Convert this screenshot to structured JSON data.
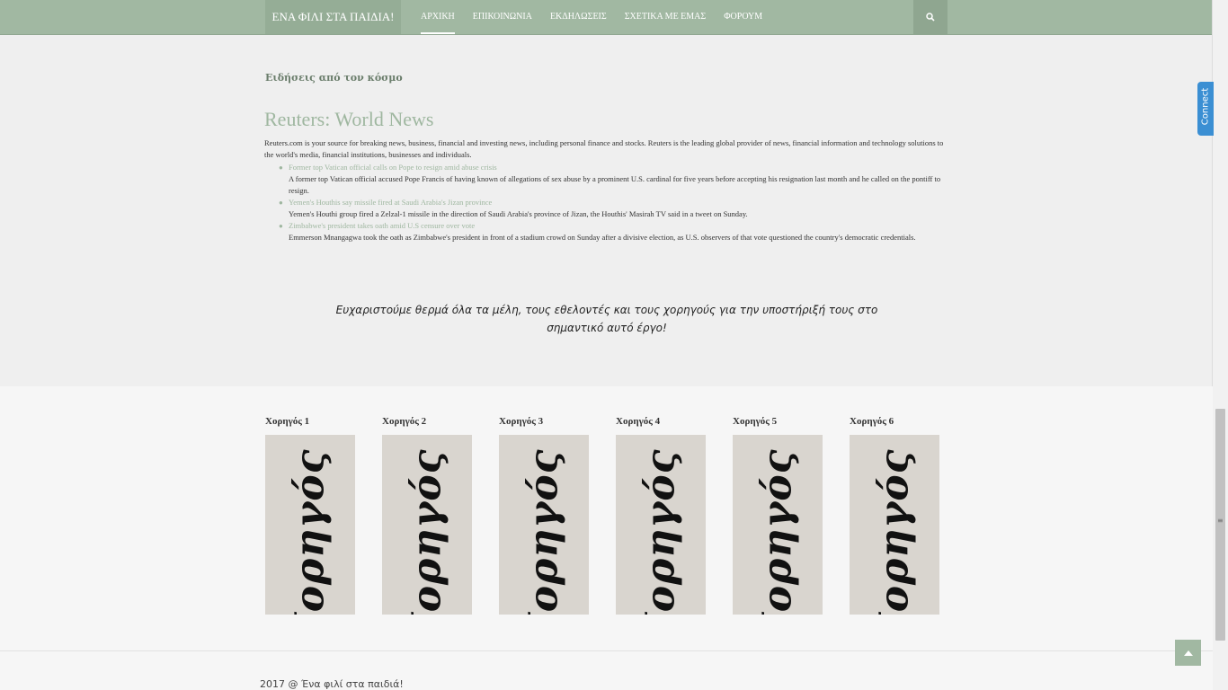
{
  "header": {
    "brand": "ΕΝΑ ΦΙΛΙ ΣΤΑ ΠΑΙΔΙΑ!",
    "nav": [
      {
        "label": "ΑΡΧΙΚΗ",
        "active": true
      },
      {
        "label": "ΕΠΙΚΟΙΝΩΝΙΑ",
        "active": false
      },
      {
        "label": "ΕΚΔΗΛΩΣΕΙΣ",
        "active": false
      },
      {
        "label": "ΣΧΕΤΙΚΑ ΜΕ ΕΜΑΣ",
        "active": false
      },
      {
        "label": "ΦΟΡΟΥΜ",
        "active": false
      }
    ],
    "search_icon": "search-icon"
  },
  "connect_tab": {
    "label": "Connect"
  },
  "news": {
    "heading": "Ειδήσεις από τον κόσμο",
    "feed_title": "Reuters: World News",
    "feed_description": "Reuters.com is your source for breaking news, business, financial and investing news, including personal finance and stocks. Reuters is the leading global provider of news, financial information and technology solutions to the world's media, financial institutions, businesses and individuals.",
    "items": [
      {
        "title": "Former top Vatican official calls on Pope to resign amid abuse crisis",
        "summary": "A former top Vatican official accused Pope Francis of having known of allegations of sex abuse by a prominent U.S. cardinal for five years before accepting his resignation last month and he called on the pontiff to resign."
      },
      {
        "title": "Yemen's Houthis say missile fired at Saudi Arabia's Jizan province",
        "summary": "Yemen's Houthi group fired a Zelzal-1 missile in the direction of Saudi Arabia's province of Jizan, the Houthis' Masirah TV said in a tweet on Sunday."
      },
      {
        "title": "Zimbabwe's president takes oath amid U.S censure over vote",
        "summary": "Emmerson Mnangagwa took the oath as Zimbabwe's president in front of a stadium crowd on Sunday after a divisive election, as U.S. observers of that vote questioned the country's democratic credentials."
      }
    ]
  },
  "thanks_text": "Ευχαριστούμε θερμά όλα τα μέλη, τους εθελοντές και τους χορηγούς για την υποστήριξή τους στο σημαντικό αυτό έργο!",
  "sponsors": [
    {
      "label": "Χορηγός 1",
      "image_text": "Χορηγός 1"
    },
    {
      "label": "Χορηγός 2",
      "image_text": "Χορηγός 2"
    },
    {
      "label": "Χορηγός 3",
      "image_text": "Χορηγός 3"
    },
    {
      "label": "Χορηγός 4",
      "image_text": "Χορηγός 4"
    },
    {
      "label": "Χορηγός 5",
      "image_text": "Χορηγός 5"
    },
    {
      "label": "Χορηγός 6",
      "image_text": "Χορηγός 6"
    }
  ],
  "footer": {
    "text": "2017 @ Ένα φιλί στα παιδιά!"
  },
  "colors": {
    "nav_bg": "#a1b8a2",
    "accent": "#9fb7a0",
    "connect": "#3b8fd3"
  }
}
